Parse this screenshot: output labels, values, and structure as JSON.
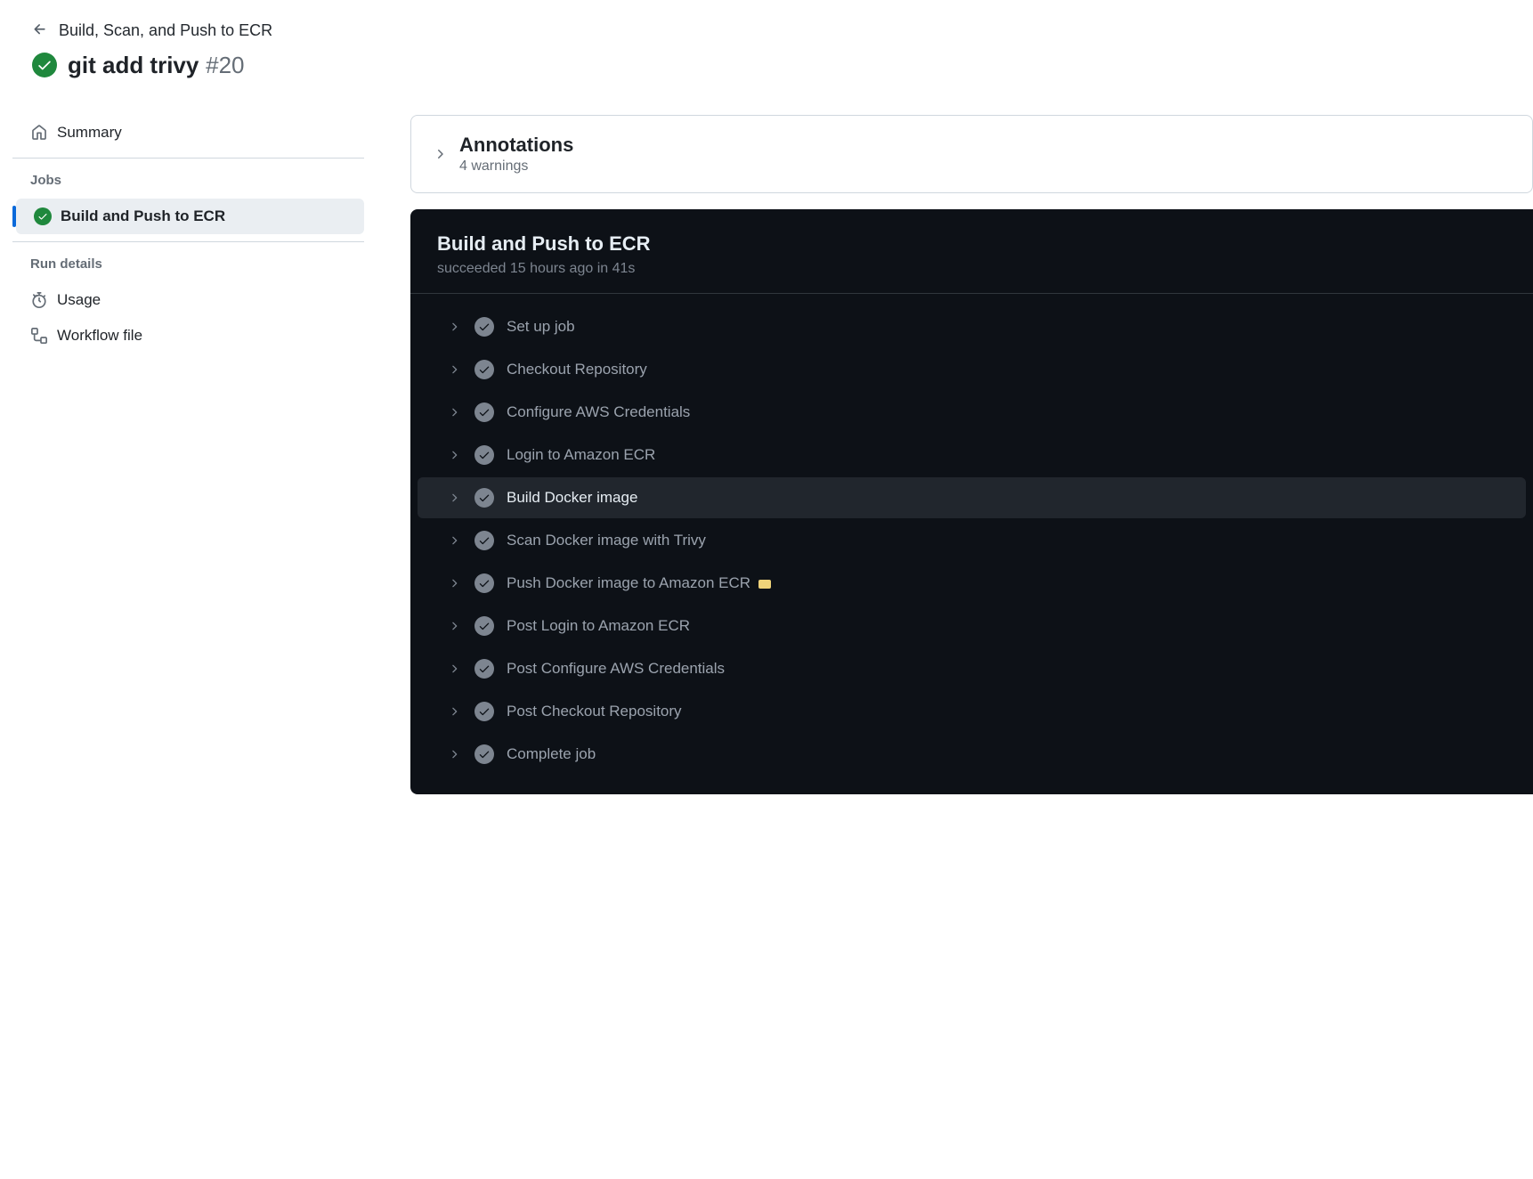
{
  "breadcrumb": {
    "workflow_name": "Build, Scan, and Push to ECR"
  },
  "run": {
    "title": "git add trivy",
    "number": "#20"
  },
  "sidebar": {
    "summary_label": "Summary",
    "jobs_heading": "Jobs",
    "jobs": [
      {
        "label": "Build and Push to ECR",
        "status": "success",
        "selected": true
      }
    ],
    "run_details_heading": "Run details",
    "usage_label": "Usage",
    "workflow_file_label": "Workflow file"
  },
  "annotations": {
    "title": "Annotations",
    "subtitle": "4 warnings"
  },
  "job_detail": {
    "title": "Build and Push to ECR",
    "status_text": "succeeded 15 hours ago in 41s",
    "steps": [
      {
        "label": "Set up job",
        "status": "success",
        "hovered": false,
        "badge": false
      },
      {
        "label": "Checkout Repository",
        "status": "success",
        "hovered": false,
        "badge": false
      },
      {
        "label": "Configure AWS Credentials",
        "status": "success",
        "hovered": false,
        "badge": false
      },
      {
        "label": "Login to Amazon ECR",
        "status": "success",
        "hovered": false,
        "badge": false
      },
      {
        "label": "Build Docker image",
        "status": "success",
        "hovered": true,
        "badge": false
      },
      {
        "label": "Scan Docker image with Trivy",
        "status": "success",
        "hovered": false,
        "badge": false
      },
      {
        "label": "Push Docker image to Amazon ECR",
        "status": "success",
        "hovered": false,
        "badge": true
      },
      {
        "label": "Post Login to Amazon ECR",
        "status": "success",
        "hovered": false,
        "badge": false
      },
      {
        "label": "Post Configure AWS Credentials",
        "status": "success",
        "hovered": false,
        "badge": false
      },
      {
        "label": "Post Checkout Repository",
        "status": "success",
        "hovered": false,
        "badge": false
      },
      {
        "label": "Complete job",
        "status": "success",
        "hovered": false,
        "badge": false
      }
    ]
  }
}
